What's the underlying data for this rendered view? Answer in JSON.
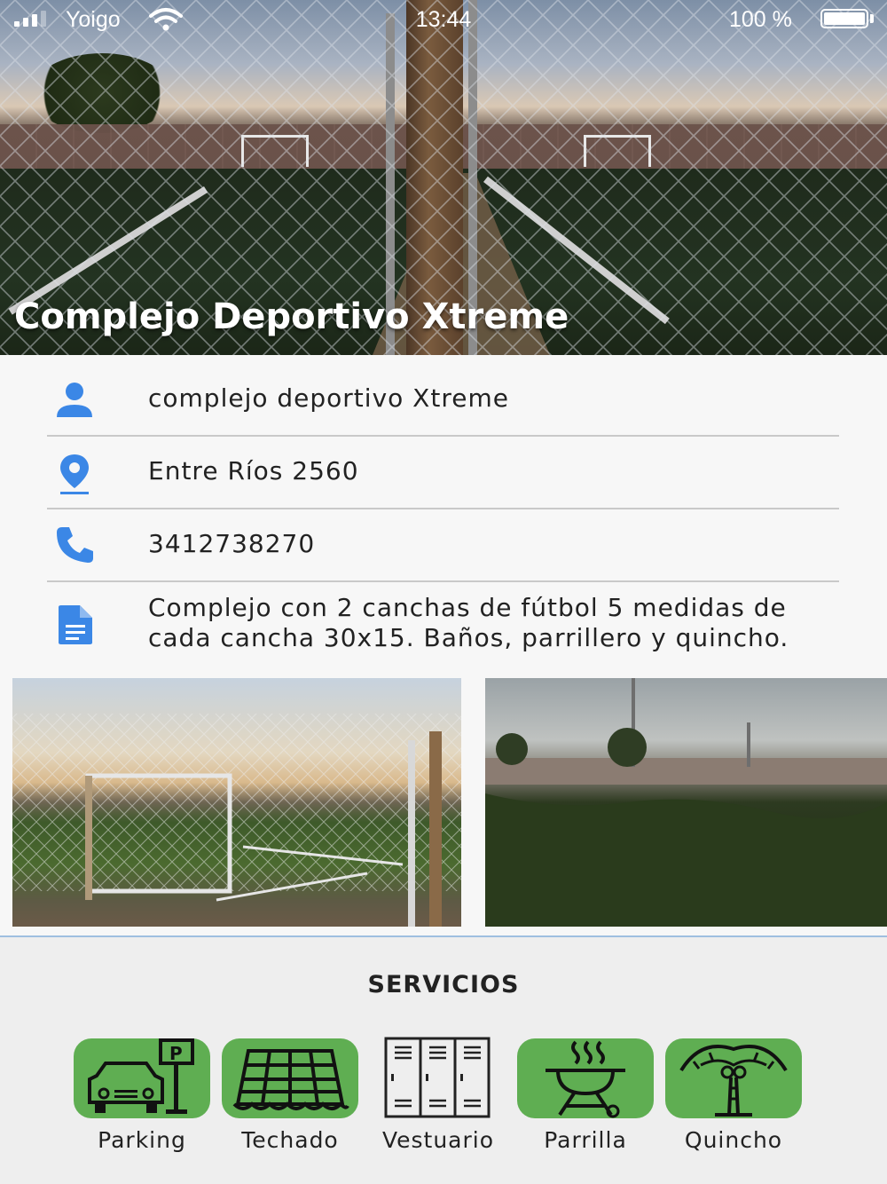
{
  "status_bar": {
    "carrier": "Yoigo",
    "time": "13:44",
    "battery": "100 %"
  },
  "venue": {
    "title": "Complejo Deportivo Xtreme"
  },
  "info": {
    "name": "complejo deportivo Xtreme",
    "address": "Entre Ríos 2560",
    "phone": "3412738270",
    "description_line1": "Complejo con 2 canchas de fútbol 5 medidas de",
    "description_line2": "cada cancha 30x15. Baños, parrillero y quincho."
  },
  "services": {
    "title": "SERVICIOS",
    "items": [
      {
        "label": "Parking",
        "icon": "parking-icon"
      },
      {
        "label": "Techado",
        "icon": "roof-icon"
      },
      {
        "label": "Vestuario",
        "icon": "locker-icon"
      },
      {
        "label": "Parrilla",
        "icon": "grill-icon"
      },
      {
        "label": "Quincho",
        "icon": "palm-icon"
      }
    ]
  },
  "colors": {
    "accent_blue": "#3b87e6",
    "service_green": "#5fae52"
  }
}
